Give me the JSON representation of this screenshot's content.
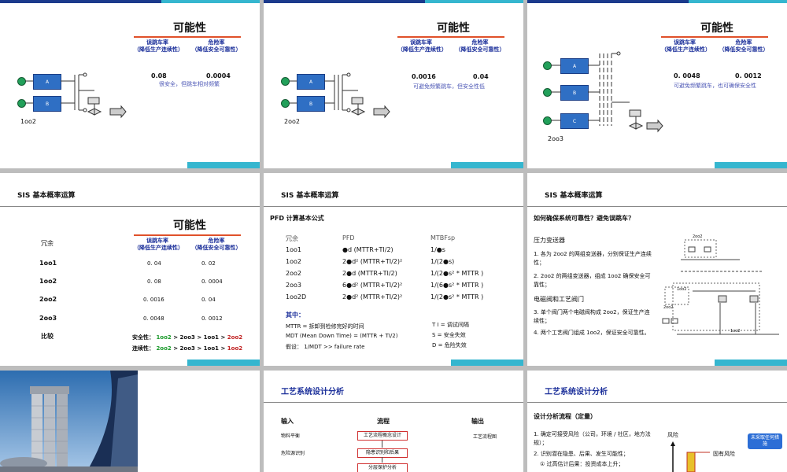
{
  "s1": {
    "title": "可能性",
    "h1": "误跳车率",
    "h1s": "（降低生产连续性）",
    "h2": "危险率",
    "h2s": "（降低安全可靠性）",
    "v1": "0.08",
    "v2": "0.0004",
    "note": "很安全，但跳车相对频繁",
    "arch": "1oo2",
    "a": "A",
    "b": "B"
  },
  "s2": {
    "title": "可能性",
    "h1": "误跳车率",
    "h1s": "（降低生产连续性）",
    "h2": "危险率",
    "h2s": "（降低安全可靠性）",
    "v1": "0.0016",
    "v2": "0.04",
    "note": "可避免频繁跳车，但安全性低",
    "arch": "2oo2",
    "a": "A",
    "b": "B"
  },
  "s3": {
    "title": "可能性",
    "h1": "误跳车率",
    "h1s": "（降低生产连续性）",
    "h2": "危险率",
    "h2s": "（降低安全可靠性）",
    "v1": "0. 0048",
    "v2": "0. 0012",
    "note": "可避免频繁跳车，也可确保安全性",
    "arch": "2oo3",
    "a": "A",
    "b": "B",
    "c": "C"
  },
  "s4": {
    "head": "SIS 基本概率运算",
    "title": "可能性",
    "col0": "冗余",
    "h1": "误跳车率",
    "h1s": "（降低生产连续性）",
    "h2": "危险率",
    "h2s": "（降低安全可靠性）",
    "rows": [
      {
        "n": "1oo1",
        "a": "0. 04",
        "b": "0. 02"
      },
      {
        "n": "1oo2",
        "a": "0. 08",
        "b": "0. 0004"
      },
      {
        "n": "2oo2",
        "a": "0. 0016",
        "b": "0. 04"
      },
      {
        "n": "2oo3",
        "a": "0. 0048",
        "b": "0. 0012"
      }
    ],
    "cmp": "比较",
    "safe_l": "安全性：",
    "safe": [
      "1oo2",
      ">",
      "2oo3",
      ">",
      "1oo1",
      ">",
      "2oo2"
    ],
    "cont_l": "连续性：",
    "cont": [
      "2oo2",
      ">",
      "2oo3",
      ">",
      "1oo1",
      ">",
      "1oo2"
    ]
  },
  "s5": {
    "head": "SIS 基本概率运算",
    "sub": "PFD 计算基本公式",
    "c0": "冗余",
    "c1": "PFD",
    "c2": "MTBFsp",
    "rows": [
      {
        "n": "1oo1",
        "p": "●d (MTTR+TI/2)",
        "m": "1/●s"
      },
      {
        "n": "1oo2",
        "p": "2●d² (MTTR+TI/2)²",
        "m": "1/(2●s)"
      },
      {
        "n": "2oo2",
        "p": "2●d (MTTR+TI/2)",
        "m": "1/(2●s² * MTTR )"
      },
      {
        "n": "2oo3",
        "p": "6●d² (MTTR+TI/2)²",
        "m": "1/(6●s² * MTTR )"
      },
      {
        "n": "1oo2D",
        "p": "2●d² (MTTR+TI/2)²",
        "m": "1/(2●s² * MTTR )"
      }
    ],
    "other": "其中：",
    "d1": "MTTR =  拆卸到检修完好的时间",
    "d2": "MDT (Mean Down Time) = (MTTR + TI/2)",
    "d3": "假设：  1/MDT >> failure rate",
    "r1": "T I =   调试间隔",
    "r2": "S   =   安全失效",
    "r3": "D   =   危险失效"
  },
  "s6": {
    "head": "SIS 基本概率运算",
    "q": "如何确保系统可靠性？避免误跳车？",
    "sec1": "压力变送器",
    "i1": "1.   各为 2oo2 的两组变送器，分别保证生产连续性；",
    "i2": "2.   2oo2 的两组变送器，组成 1oo2 确保安全可靠性；",
    "sec2": "电磁阀和工艺阀门",
    "i3": "3.   单个阀门两个电磁阀构成 2oo2，保证生产连续性；",
    "i4": "4.   两个工艺阀门组成 1oo2，保证安全可靠性。",
    "lbl1": "2oo2",
    "lbl2": "1oo2",
    "lbl3": "2oo2",
    "lbl4": "1oo2"
  },
  "s8": {
    "title": "工艺系统设计分析",
    "in": "输入",
    "flow": "流程",
    "out": "输出",
    "i1": "物料平衡",
    "i2": "危险源识别",
    "f1": "工艺流程概念设计",
    "f2": "隐患识别和后果",
    "f3": "分层保护分析",
    "o1": "工艺流程图"
  },
  "s9": {
    "title": "工艺系统设计分析",
    "sub": "设计分析流程（定量）",
    "l1": "1.   确定可接受风险（公司，环境 / 社区，地方法规）；",
    "l2": "2.   识别潜在隐患、后果、发生可能性；",
    "l3": "①    过高估计后果：投资成本上升；",
    "risk": "风险",
    "inh": "固有风险",
    "c1": "未采取任何措施"
  }
}
